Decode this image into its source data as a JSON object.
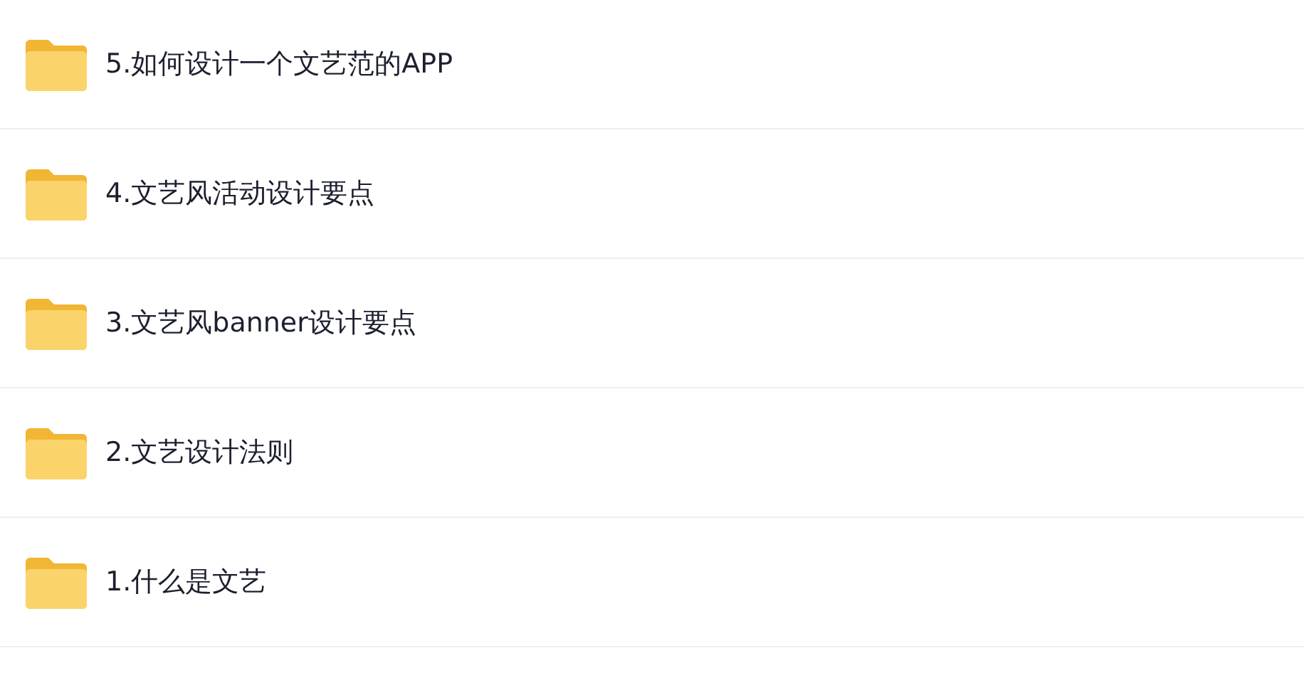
{
  "folders": [
    {
      "name": "5.如何设计一个文艺范的APP"
    },
    {
      "name": "4.文艺风活动设计要点"
    },
    {
      "name": "3.文艺风banner设计要点"
    },
    {
      "name": "2.文艺设计法则"
    },
    {
      "name": "1.什么是文艺"
    }
  ]
}
